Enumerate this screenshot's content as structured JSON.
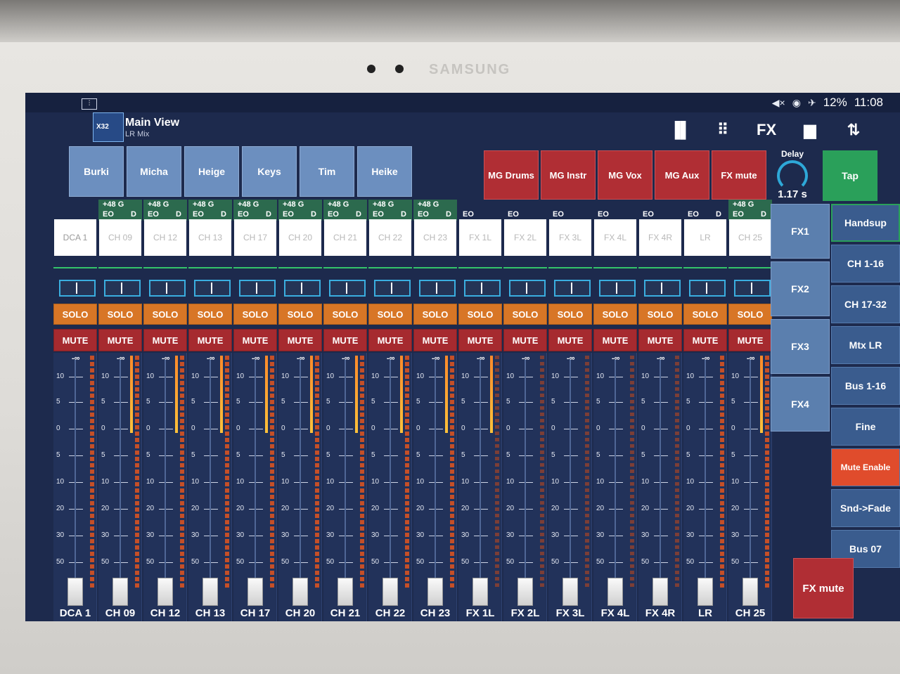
{
  "device": {
    "brand": "SAMSUNG"
  },
  "status_bar": {
    "battery": "12%",
    "time": "11:08"
  },
  "header": {
    "logo_text": "X32",
    "title": "Main View",
    "subtitle": "LR Mix",
    "toolbar": [
      {
        "name": "meters-icon",
        "glyph": "▐▌"
      },
      {
        "name": "grid-icon",
        "glyph": "⠿"
      },
      {
        "name": "fx-label",
        "glyph": "FX"
      },
      {
        "name": "folder-icon",
        "glyph": "▆"
      },
      {
        "name": "sync-icon",
        "glyph": "⇅"
      }
    ]
  },
  "dca_groups": [
    "Burki",
    "Micha",
    "Heige",
    "Keys",
    "Tim",
    "Heike"
  ],
  "mute_groups": [
    "MG Drums",
    "MG Instr",
    "MG Vox",
    "MG Aux",
    "FX mute"
  ],
  "delay": {
    "label": "Delay",
    "value": "1.17 s"
  },
  "tap_label": "Tap",
  "strip_labels": {
    "solo": "SOLO",
    "mute": "MUTE",
    "neg_inf": "-∞"
  },
  "scale_ticks": [
    "10",
    "5",
    "0",
    "5",
    "10",
    "20",
    "30",
    "50"
  ],
  "channels": [
    {
      "name": "DCA 1",
      "eq": "",
      "g": "",
      "phantom": ""
    },
    {
      "name": "CH 09",
      "eq": "EO",
      "g": "D",
      "phantom": "+48 G"
    },
    {
      "name": "CH 12",
      "eq": "EO",
      "g": "D",
      "phantom": "+48 G"
    },
    {
      "name": "CH 13",
      "eq": "EO",
      "g": "D",
      "phantom": "+48 G"
    },
    {
      "name": "CH 17",
      "eq": "EO",
      "g": "D",
      "phantom": "+48 G"
    },
    {
      "name": "CH 20",
      "eq": "EO",
      "g": "D",
      "phantom": "+48 G"
    },
    {
      "name": "CH 21",
      "eq": "EO",
      "g": "D",
      "phantom": "+48 G"
    },
    {
      "name": "CH 22",
      "eq": "EO",
      "g": "D",
      "phantom": "+48 G"
    },
    {
      "name": "CH 23",
      "eq": "EO",
      "g": "D",
      "phantom": "+48 G"
    },
    {
      "name": "FX 1L",
      "eq": "EO",
      "g": "",
      "phantom": ""
    },
    {
      "name": "FX 2L",
      "eq": "EO",
      "g": "",
      "phantom": ""
    },
    {
      "name": "FX 3L",
      "eq": "EO",
      "g": "",
      "phantom": ""
    },
    {
      "name": "FX 4L",
      "eq": "EO",
      "g": "",
      "phantom": ""
    },
    {
      "name": "FX 4R",
      "eq": "EO",
      "g": "",
      "phantom": ""
    },
    {
      "name": "LR",
      "eq": "EO",
      "g": "D",
      "phantom": ""
    },
    {
      "name": "CH 25",
      "eq": "EO",
      "g": "D",
      "phantom": "+48 G"
    }
  ],
  "fx_buttons": [
    "FX1",
    "FX2",
    "FX3",
    "FX4"
  ],
  "side_buttons": [
    "Handsup",
    "CH 1-16",
    "CH 17-32",
    "Mtx LR",
    "Bus 1-16",
    "Fine",
    "Mute Enable",
    "Snd->Fade",
    "Bus 07"
  ],
  "fx_mute_bottom": "FX mute",
  "colors": {
    "accent_green": "#2aa05a",
    "solo": "#d87626",
    "mute": "#a62a2f",
    "dca": "#6c8fbf"
  }
}
